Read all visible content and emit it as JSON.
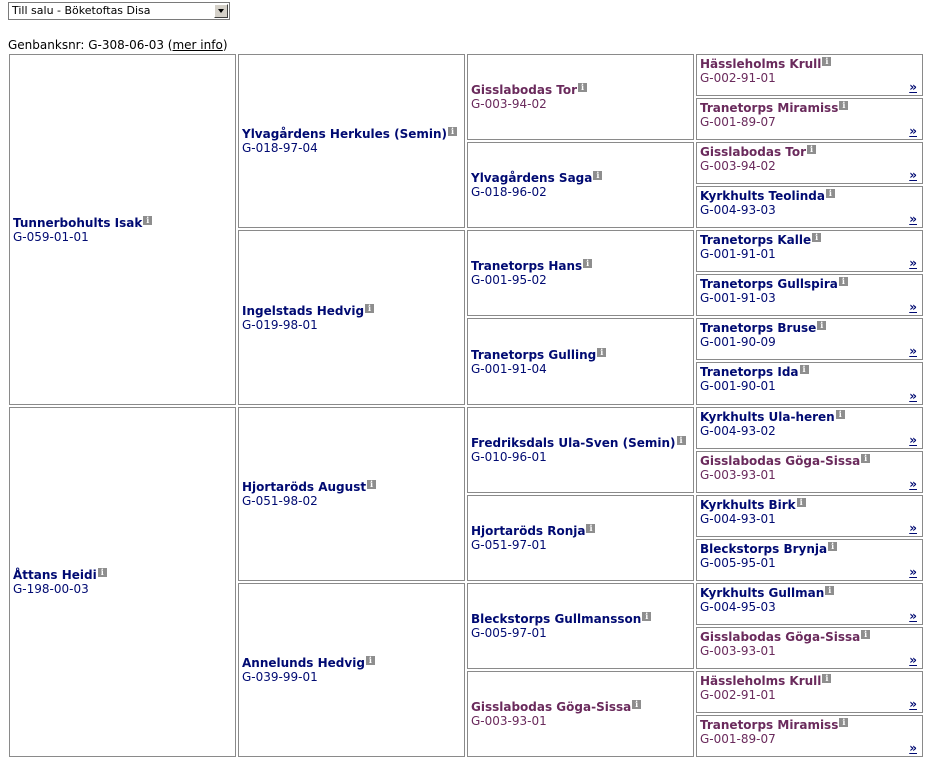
{
  "selector": {
    "value": "Till salu - Böketoftas Disa"
  },
  "genbank": {
    "label": "Genbanksnr: G-308-06-03 (",
    "link": "mer info",
    "close": ")"
  },
  "more_symbol": "»",
  "info_symbol": "i",
  "gen1": [
    {
      "name": "Tunnerbohults Isak",
      "reg": "G-059-01-01",
      "sex": "m"
    },
    {
      "name": "Åttans Heidi",
      "reg": "G-198-00-03",
      "sex": "m"
    }
  ],
  "gen2": [
    {
      "name": "Ylvagårdens Herkules (Semin)",
      "reg": "G-018-97-04",
      "sex": "m"
    },
    {
      "name": "Ingelstads Hedvig",
      "reg": "G-019-98-01",
      "sex": "m"
    },
    {
      "name": "Hjortaröds August",
      "reg": "G-051-98-02",
      "sex": "m"
    },
    {
      "name": "Annelunds Hedvig",
      "reg": "G-039-99-01",
      "sex": "m"
    }
  ],
  "gen3": [
    {
      "name": "Gisslabodas Tor",
      "reg": "G-003-94-02",
      "sex": "f"
    },
    {
      "name": "Ylvagårdens Saga",
      "reg": "G-018-96-02",
      "sex": "m"
    },
    {
      "name": "Tranetorps Hans",
      "reg": "G-001-95-02",
      "sex": "m"
    },
    {
      "name": "Tranetorps Gulling",
      "reg": "G-001-91-04",
      "sex": "m"
    },
    {
      "name": "Fredriksdals Ula-Sven (Semin)",
      "reg": "G-010-96-01",
      "sex": "m"
    },
    {
      "name": "Hjortaröds Ronja",
      "reg": "G-051-97-01",
      "sex": "m"
    },
    {
      "name": "Bleckstorps Gullmansson",
      "reg": "G-005-97-01",
      "sex": "m"
    },
    {
      "name": "Gisslabodas Göga-Sissa",
      "reg": "G-003-93-01",
      "sex": "f"
    }
  ],
  "gen4": [
    {
      "name": "Hässleholms Krull",
      "reg": "G-002-91-01",
      "sex": "f"
    },
    {
      "name": "Tranetorps Miramiss",
      "reg": "G-001-89-07",
      "sex": "f"
    },
    {
      "name": "Gisslabodas Tor",
      "reg": "G-003-94-02",
      "sex": "f"
    },
    {
      "name": "Kyrkhults Teolinda",
      "reg": "G-004-93-03",
      "sex": "m"
    },
    {
      "name": "Tranetorps Kalle",
      "reg": "G-001-91-01",
      "sex": "m"
    },
    {
      "name": "Tranetorps Gullspira",
      "reg": "G-001-91-03",
      "sex": "m"
    },
    {
      "name": "Tranetorps Bruse",
      "reg": "G-001-90-09",
      "sex": "m"
    },
    {
      "name": "Tranetorps Ida",
      "reg": "G-001-90-01",
      "sex": "m"
    },
    {
      "name": "Kyrkhults Ula-heren",
      "reg": "G-004-93-02",
      "sex": "m"
    },
    {
      "name": "Gisslabodas Göga-Sissa",
      "reg": "G-003-93-01",
      "sex": "f"
    },
    {
      "name": "Kyrkhults Birk",
      "reg": "G-004-93-01",
      "sex": "m"
    },
    {
      "name": "Bleckstorps Brynja",
      "reg": "G-005-95-01",
      "sex": "m"
    },
    {
      "name": "Kyrkhults Gullman",
      "reg": "G-004-95-03",
      "sex": "m"
    },
    {
      "name": "Gisslabodas Göga-Sissa",
      "reg": "G-003-93-01",
      "sex": "f"
    },
    {
      "name": "Hässleholms Krull",
      "reg": "G-002-91-01",
      "sex": "f"
    },
    {
      "name": "Tranetorps Miramiss",
      "reg": "G-001-89-07",
      "sex": "f"
    }
  ]
}
